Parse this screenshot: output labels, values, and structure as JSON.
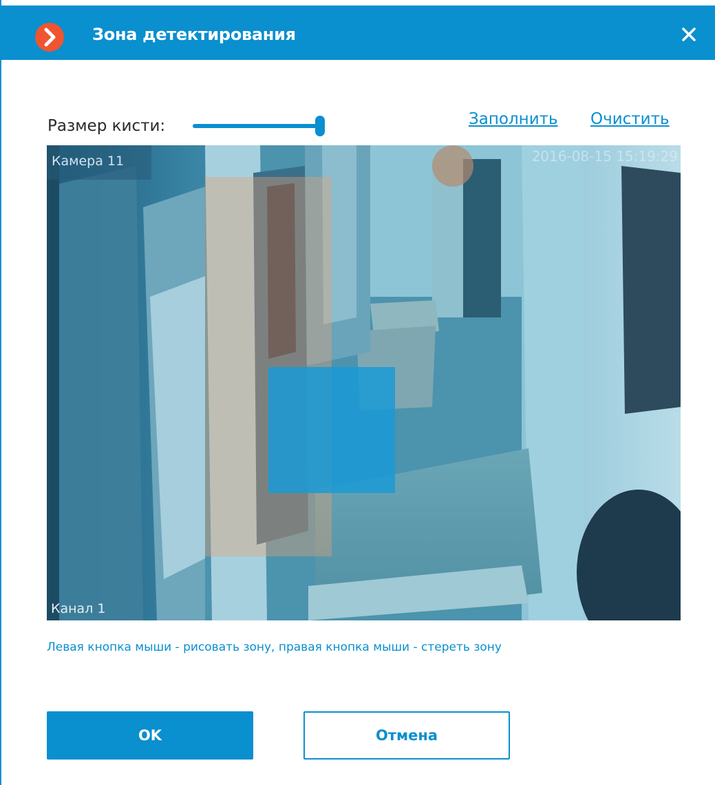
{
  "dialog": {
    "title": "Зона детектирования",
    "close_icon": "close-icon",
    "logo_icon": "chevron-right-icon"
  },
  "brush": {
    "label": "Размер кисти:",
    "size_fraction": 1.0
  },
  "actions": {
    "fill_label": "Заполнить",
    "clear_label": "Очистить"
  },
  "video": {
    "camera_label": "Камера 11",
    "timestamp": "2016-08-15 15:19:29",
    "channel_label": "Канал 1"
  },
  "hint": "Левая кнопка мыши - рисовать зону, правая кнопка мыши - стереть зону",
  "buttons": {
    "ok_label": "OK",
    "cancel_label": "Отмена"
  },
  "colors": {
    "accent": "#0a8fcf",
    "logo": "#ef5530",
    "zone_overlay": "#1a9ad6"
  }
}
